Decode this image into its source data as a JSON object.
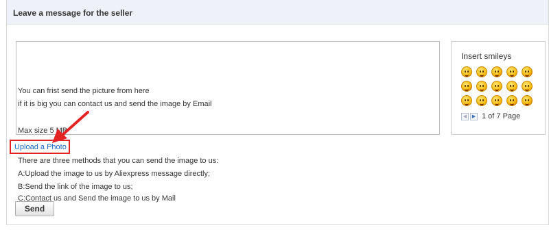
{
  "panel": {
    "title": "Leave a message for the seller"
  },
  "message_box": {
    "lines": [
      "You can frist send the picture from here",
      "if it is big you can contact us and send the image by Email",
      "Max size 5 MB"
    ]
  },
  "smileys": {
    "title": "Insert smileys",
    "icons": [
      "smile-face-icon",
      "wink-face-icon",
      "tongue-face-icon",
      "laugh-face-icon",
      "hug-face-icon",
      "shout-face-icon",
      "grin-face-icon",
      "cool-face-icon",
      "shy-face-icon",
      "sleepy-face-icon",
      "cry-face-icon",
      "kiss-face-icon",
      "devil-face-icon",
      "surprise-face-icon",
      "love-face-icon"
    ],
    "pager": {
      "prev_icon": "chevron-left-icon",
      "next_icon": "chevron-right-icon",
      "text": "1 of 7 Page"
    }
  },
  "upload": {
    "link_text": "Upload a Photo",
    "highlight_color": "#e32224"
  },
  "info": {
    "lines": [
      "There are three methods that you can send the image to us:",
      "A:Upload the image to us by Aliexpress message directly;",
      "B:Send the link of the image to us;",
      "C:Contact us and Send the image to us by Mail"
    ]
  },
  "send_button": {
    "label": "Send"
  },
  "colors": {
    "link": "#1a66c0",
    "annotation_red": "#e32224",
    "header_bg": "#eef2f8"
  }
}
